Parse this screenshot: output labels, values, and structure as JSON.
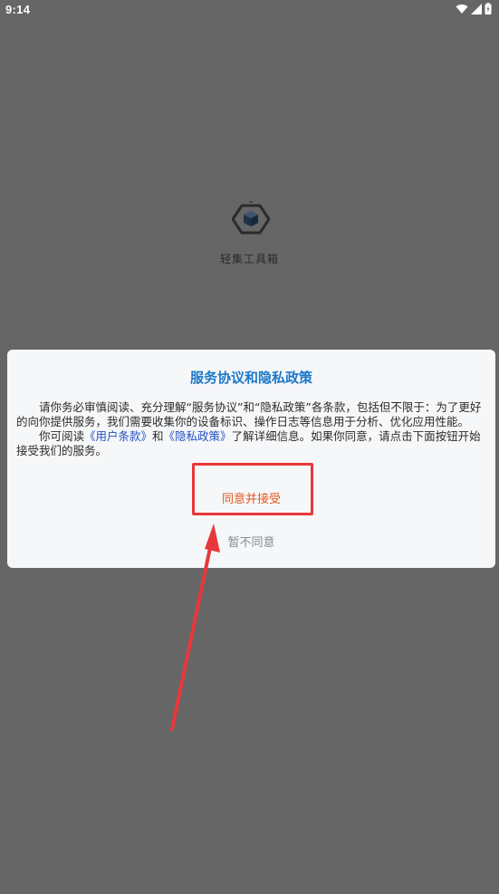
{
  "status_bar": {
    "time": "9:14",
    "icons": [
      "wifi-icon",
      "cellular-signal-icon",
      "battery-icon"
    ]
  },
  "splash": {
    "app_name": "轻集工具箱",
    "logo_icon": "cube-hexagon-logo-icon"
  },
  "dialog": {
    "title": "服务协议和隐私政策",
    "paragraph1": "请你务必审慎阅读、充分理解“服务协议”和“隐私政策”各条款，包括但不限于：为了更好的向你提供服务，我们需要收集你的设备标识、操作日志等信息用于分析、优化应用性能。",
    "paragraph2_prefix": "你可阅读",
    "user_terms_link": "《用户条款》",
    "paragraph2_and": "和",
    "privacy_policy_link": "《隐私政策》",
    "paragraph2_suffix": "了解详细信息。如果你同意，请点击下面按钮开始接受我们的服务。",
    "agree_label": "同意并接受",
    "decline_label": "暂不同意"
  },
  "colors": {
    "background_overlay": "#666666",
    "dialog_background": "#f6f7f9",
    "title_color": "#1a78c8",
    "link_color": "#2350c4",
    "agree_color": "#e2571d",
    "decline_color": "#858a94",
    "annotation_red": "#e8373a"
  }
}
